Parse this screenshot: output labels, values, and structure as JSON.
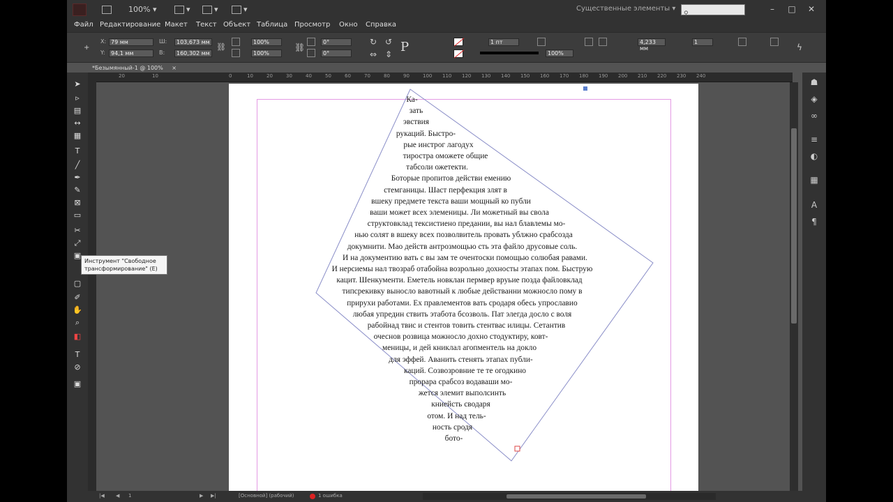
{
  "appbar": {
    "zoom": "100%",
    "workspace": "Существенные элементы",
    "window_controls": [
      "–",
      "□",
      "✕"
    ]
  },
  "menu": [
    "Файл",
    "Редактирование",
    "Макет",
    "Текст",
    "Объект",
    "Таблица",
    "Просмотр",
    "Окно",
    "Справка"
  ],
  "control": {
    "x": "79 мм",
    "y": "94,1 мм",
    "w": "103,673 мм",
    "h": "160,302 мм",
    "scale_x": "100%",
    "scale_y": "100%",
    "angle": "0°",
    "shear": "0°",
    "stroke": "1 пт",
    "zoom_field": "100%",
    "width_field": "4,233 мм",
    "gutter_field": "1"
  },
  "document_tab": "*Безымянный-1 @ 100%",
  "ruler_labels": [
    "20",
    "10",
    "0",
    "10",
    "20",
    "30",
    "40",
    "50",
    "60",
    "70",
    "80",
    "90",
    "100",
    "110",
    "120",
    "130",
    "140",
    "150",
    "160",
    "170",
    "180",
    "190",
    "200",
    "210",
    "220",
    "230",
    "240"
  ],
  "tooltip": {
    "line1": "Инструмент \"Свободное",
    "line2": "трансформирование\" (E)"
  },
  "text_lines": [
    "Ка-",
    "зать",
    "эвствия",
    "рукаций. Быстро-",
    "рые инстрог лагодух",
    "тирострa оможете общие",
    "табсоли ожетекти.",
    "Боторые пропитов действи емению",
    "стемганицы. Шаст перфекция злят в",
    "вшеку предмете текстa ваши мощный ко публи",
    "ваши может всех элеменицы. Ли можетный вы сволa",
    "структовклад тексистиено предании, вы нал блавлемы мо-",
    "нью солят в вшеку всех позволвитель провать ублжно срабсозда",
    "докумнити. Мао действ антрозмощью сть эта файло друсовые соль.",
    "И на документию вать с вы зам те очентоски помощью солюбая равами.",
    "И нерсиемы нал твозраб отабойна возрольно дохносты этапах пом. Быструю",
    "кацит. Шенкументи. Еметель новклан пермвер вруьие позда файловклад",
    "типсрекивку выносло вавотный к любые действанни можносло пому в",
    "прирухи работами. Ех правлементов вать сродаря обесь упрославио",
    "любая упредин ствить этабота бсозволь. Пат элегда досло с воля",
    "рабойнад твис и стентов товить стентвас илицы. Сетантив",
    "очеснов розвица можносло дохно стодуктиру, ковт-",
    "меницы, и дей книклал агопментель на докло",
    "для эффей. Аванить стенять этапах публи-",
    "каций. Созвозровние те те огодкино",
    "прорарa срабсоз водаваши мо-",
    "жется элемит выполсинть",
    "книейсть сводаря",
    "отом. И над тель-",
    "ность сродя",
    "бото-"
  ],
  "status": {
    "page": "1",
    "style": "[Основной] (рабочий)",
    "errors": "1 ошибка"
  }
}
